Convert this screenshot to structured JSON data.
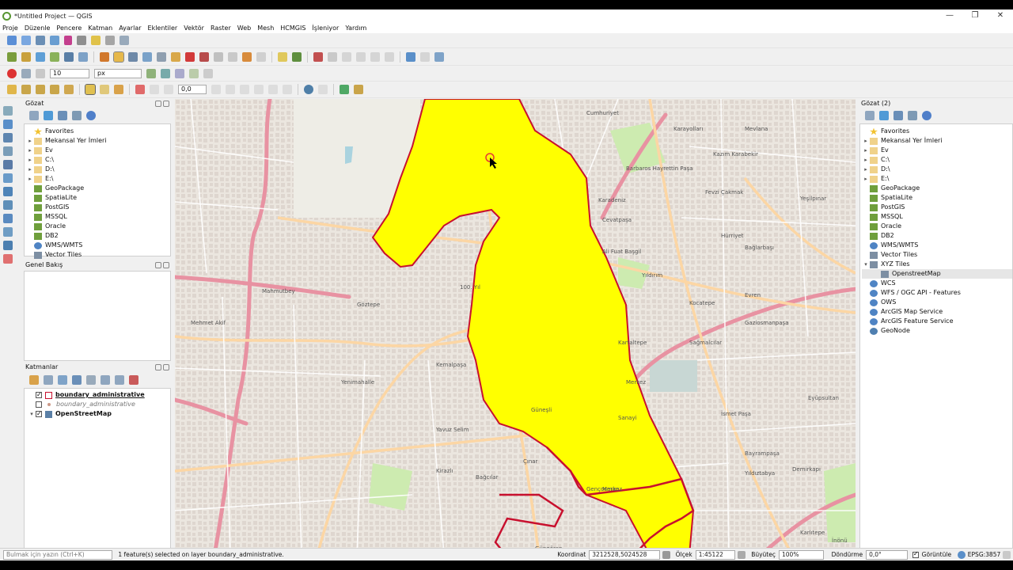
{
  "window": {
    "title": "*Untitled Project — QGIS",
    "minimize": "—",
    "maximize": "❐",
    "close": "✕"
  },
  "menu": [
    "Proje",
    "Düzenle",
    "Pencere",
    "Katman",
    "Ayarlar",
    "Eklentiler",
    "Vektör",
    "Raster",
    "Web",
    "Mesh",
    "HCMGIS",
    "İşleniyor",
    "Yardım"
  ],
  "snapping": {
    "tolerance": "10",
    "unit": "px",
    "offset": "0,0"
  },
  "browser": {
    "title": "Gözat",
    "items": [
      {
        "label": "Favorites",
        "arrow": "",
        "icon": "star"
      },
      {
        "label": "Mekansal Yer İmleri",
        "arrow": "▸",
        "icon": "folder"
      },
      {
        "label": "Ev",
        "arrow": "▸",
        "icon": "folder"
      },
      {
        "label": "C:\\",
        "arrow": "▸",
        "icon": "folder"
      },
      {
        "label": "D:\\",
        "arrow": "▸",
        "icon": "folder"
      },
      {
        "label": "E:\\",
        "arrow": "▸",
        "icon": "folder"
      },
      {
        "label": "GeoPackage",
        "arrow": "",
        "icon": "db"
      },
      {
        "label": "SpatiaLite",
        "arrow": "",
        "icon": "db"
      },
      {
        "label": "PostGIS",
        "arrow": "",
        "icon": "db"
      },
      {
        "label": "MSSQL",
        "arrow": "",
        "icon": "db"
      },
      {
        "label": "Oracle",
        "arrow": "",
        "icon": "db"
      },
      {
        "label": "DB2",
        "arrow": "",
        "icon": "db"
      },
      {
        "label": "WMS/WMTS",
        "arrow": "",
        "icon": "globe"
      },
      {
        "label": "Vector Tiles",
        "arrow": "",
        "icon": "grid"
      }
    ]
  },
  "overview": {
    "title": "Genel Bakış"
  },
  "layers": {
    "title": "Katmanlar",
    "items": [
      {
        "label": "boundary_administrative",
        "checked": true,
        "style": "bold-underline"
      },
      {
        "label": "boundary_administrative",
        "checked": false,
        "style": "italic"
      },
      {
        "label": "OpenStreetMap",
        "checked": true,
        "style": "bold"
      }
    ]
  },
  "browser2": {
    "title": "Gözat (2)",
    "items": [
      {
        "label": "Favorites",
        "arrow": "",
        "icon": "star"
      },
      {
        "label": "Mekansal Yer İmleri",
        "arrow": "▸",
        "icon": "folder"
      },
      {
        "label": "Ev",
        "arrow": "▸",
        "icon": "folder"
      },
      {
        "label": "C:\\",
        "arrow": "▸",
        "icon": "folder"
      },
      {
        "label": "D:\\",
        "arrow": "▸",
        "icon": "folder"
      },
      {
        "label": "E:\\",
        "arrow": "▸",
        "icon": "folder"
      },
      {
        "label": "GeoPackage",
        "arrow": "",
        "icon": "db"
      },
      {
        "label": "SpatiaLite",
        "arrow": "",
        "icon": "db"
      },
      {
        "label": "PostGIS",
        "arrow": "",
        "icon": "db"
      },
      {
        "label": "MSSQL",
        "arrow": "",
        "icon": "db"
      },
      {
        "label": "Oracle",
        "arrow": "",
        "icon": "db"
      },
      {
        "label": "DB2",
        "arrow": "",
        "icon": "db"
      },
      {
        "label": "WMS/WMTS",
        "arrow": "",
        "icon": "globe"
      },
      {
        "label": "Vector Tiles",
        "arrow": "",
        "icon": "grid"
      },
      {
        "label": "XYZ Tiles",
        "arrow": "▾",
        "icon": "grid"
      },
      {
        "label": "OpenstreetMap",
        "arrow": "",
        "icon": "grid",
        "indent": true,
        "selected": true
      },
      {
        "label": "WCS",
        "arrow": "",
        "icon": "globe"
      },
      {
        "label": "WFS / OGC API - Features",
        "arrow": "",
        "icon": "globe"
      },
      {
        "label": "OWS",
        "arrow": "",
        "icon": "globe"
      },
      {
        "label": "ArcGIS Map Service",
        "arrow": "",
        "icon": "globe"
      },
      {
        "label": "ArcGIS Feature Service",
        "arrow": "",
        "icon": "globe"
      },
      {
        "label": "GeoNode",
        "arrow": "",
        "icon": "geo"
      }
    ]
  },
  "map_labels": [
    "Cumhuriyet",
    "Karayolları",
    "Mevlana",
    "Kazım Karabekir",
    "Barbaros Hayrettin Paşa",
    "Karadeniz",
    "Fevzi Çakmak",
    "Yeşilpınar",
    "Cevatpaşa",
    "Ali Fuat Başgil",
    "Hürriyet",
    "Bağlarbaşı",
    "Yıldırım",
    "Kocatepe",
    "Gaziosmanpaşa",
    "Kartaltepe",
    "Sağmalcılar",
    "Merkez",
    "Eyüpsultan",
    "İsmet Paşa",
    "Bayrampaşa",
    "Mahmutbey",
    "Mehmet Akif",
    "Göztepe",
    "Kemalpaşa",
    "Yenimahalle",
    "Güneşli",
    "Bağcılar",
    "Güngören",
    "Gençosman",
    "Kirazlı",
    "Yavuz Selim",
    "Merkez",
    "İnönü",
    "Sanayi",
    "Çınar",
    "100. Yıl",
    "Evren",
    "Demirkapı",
    "Yıldıztabya",
    "Karlıtepe"
  ],
  "status": {
    "search_placeholder": "Bulmak için yazın (Ctrl+K)",
    "message": "1 feature(s) selected on layer boundary_administrative.",
    "coord_label": "Koordinat",
    "coord": "3212528,5024528",
    "scale_label": "Ölçek",
    "scale": "1:45122",
    "mag_label": "Büyüteç",
    "mag": "100%",
    "rot_label": "Döndürme",
    "rot": "0,0°",
    "render_label": "Görüntüle",
    "crs": "EPSG:3857"
  },
  "colors": {
    "selection": "#ffff00",
    "boundary": "#c8102e",
    "osm_bg": "#f2efe9",
    "major_road": "#e892a2",
    "primary": "#fcd6a4",
    "green": "#cdebb0"
  }
}
